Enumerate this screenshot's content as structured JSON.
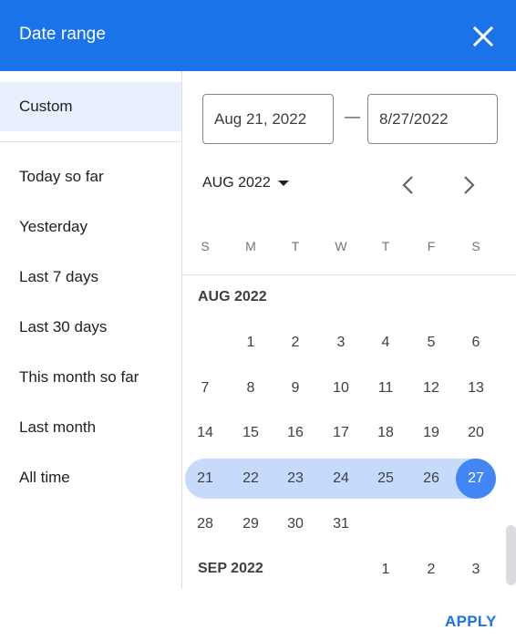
{
  "header": {
    "title": "Date range",
    "close_icon": "close-icon"
  },
  "sidebar": {
    "custom_label": "Custom",
    "presets": [
      "Today so far",
      "Yesterday",
      "Last 7 days",
      "Last 30 days",
      "This month so far",
      "Last month",
      "All time"
    ]
  },
  "inputs": {
    "start_value": "Aug 21, 2022",
    "separator": "—",
    "end_value": "8/27/2022"
  },
  "calendar": {
    "month_select_label": "AUG 2022",
    "prev_icon": "chevron-left-icon",
    "next_icon": "chevron-right-icon",
    "weekdays": [
      "S",
      "M",
      "T",
      "W",
      "T",
      "F",
      "S"
    ],
    "months": [
      {
        "label": "AUG 2022",
        "first_weekday": 1,
        "days": 31
      },
      {
        "label": "SEP 2022",
        "first_weekday": 4,
        "visible_days": 3
      }
    ],
    "range_start_day": 21,
    "range_end_day": 27,
    "colors": {
      "range_band": "#c6dafc",
      "selected_end": "#4285f4",
      "accent": "#1a73e8"
    }
  },
  "footer": {
    "apply_label": "APPLY"
  }
}
